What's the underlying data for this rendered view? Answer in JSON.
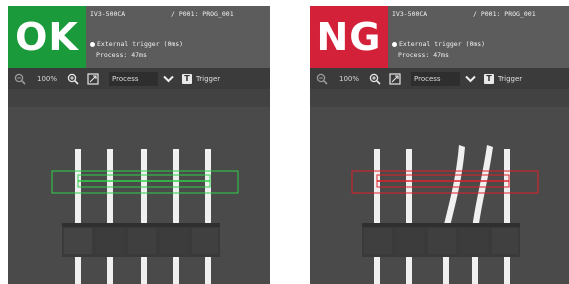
{
  "panels": [
    {
      "result": "OK",
      "result_color": "#1a9a3a",
      "model": "IV3-500CA",
      "program": "/ P001: PROG_001",
      "trigger": "External trigger (0ms)",
      "process_time": "Process: 47ms",
      "zoom": "100%",
      "mode_select": "Process",
      "trigger_button": "Trigger",
      "roi_color": "#2fd04a",
      "pins_bent": false
    },
    {
      "result": "NG",
      "result_color": "#d4213a",
      "model": "IV3-500CA",
      "program": "/ P001: PROG_001",
      "trigger": "External trigger (0ms)",
      "process_time": "Process: 47ms",
      "zoom": "100%",
      "mode_select": "Process",
      "trigger_button": "Trigger",
      "roi_color": "#e0202a",
      "pins_bent": true
    }
  ],
  "icons": {
    "zoom_out": "zoom-out-icon",
    "zoom_in": "zoom-in-icon",
    "fit": "fit-screen-icon",
    "chevron": "chevron-down-icon",
    "trigger": "trigger-icon"
  }
}
